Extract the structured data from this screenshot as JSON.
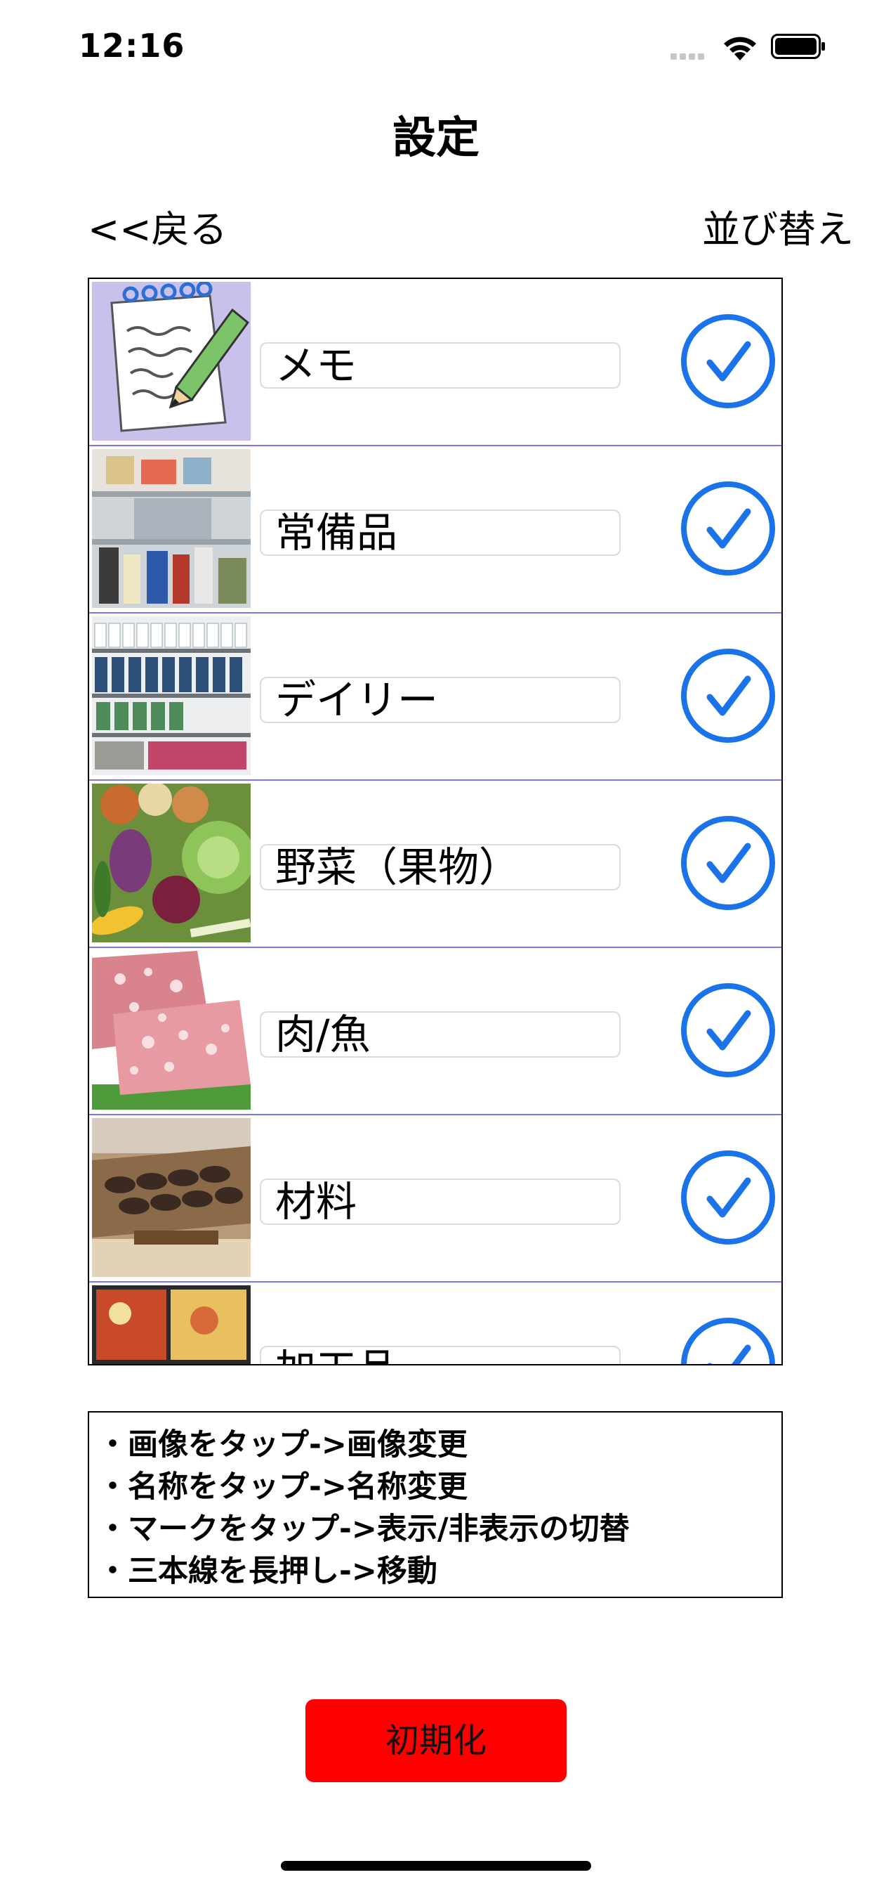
{
  "status_bar": {
    "time": "12:16"
  },
  "nav": {
    "title": "設定",
    "back_label": "<<戻る",
    "sort_label": "並び替え"
  },
  "categories": [
    {
      "name": "メモ",
      "image": "memo-pad-pencil-illustration",
      "visible": true
    },
    {
      "name": "常備品",
      "image": "refrigerator-photo",
      "visible": true
    },
    {
      "name": "デイリー",
      "image": "dairy-shelf-photo",
      "visible": true
    },
    {
      "name": "野菜（果物）",
      "image": "vegetables-photo",
      "visible": true
    },
    {
      "name": "肉/魚",
      "image": "beef-photo",
      "visible": true
    },
    {
      "name": "材料",
      "image": "dried-ingredients-photo",
      "visible": true
    },
    {
      "name": "加工品",
      "image": "prepared-food-photo",
      "visible": true
    }
  ],
  "instructions": {
    "lines": [
      "・画像をタップ->画像変更",
      "・名称をタップ->名称変更",
      "・マークをタップ->表示/非表示の切替",
      "・三本線を長押し->移動"
    ]
  },
  "reset_button": {
    "label": "初期化"
  },
  "colors": {
    "accent_blue": "#1a73e8",
    "reset_red": "#ff0000",
    "row_divider": "#7777ee"
  }
}
